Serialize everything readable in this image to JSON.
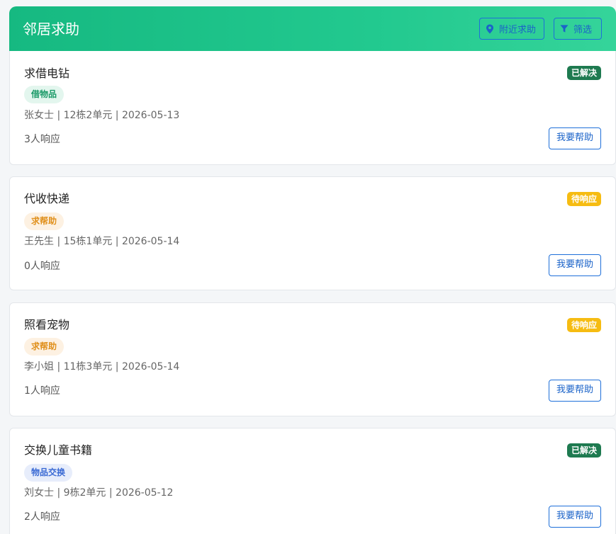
{
  "header": {
    "title": "邻居求助",
    "nearby_label": "附近求助",
    "filter_label": "筛选"
  },
  "colors": {
    "header_gradient_start": "#16b981",
    "header_gradient_end": "#35d49a",
    "solved": "#1e7a50",
    "pending": "#f6bc12",
    "action_blue": "#1e6fd9"
  },
  "icons": {
    "nearby": "map-pin-icon",
    "filter": "funnel-icon"
  },
  "posts": [
    {
      "title": "求借电钻",
      "status": "已解决",
      "status_kind": "solved",
      "tag": "借物品",
      "tag_kind": "green",
      "meta": "张女士 | 12栋2单元 | 2026-05-13",
      "responses": "3人响应",
      "action": "我要帮助"
    },
    {
      "title": "代收快递",
      "status": "待响应",
      "status_kind": "pending",
      "tag": "求帮助",
      "tag_kind": "orange",
      "meta": "王先生 | 15栋1单元 | 2026-05-14",
      "responses": "0人响应",
      "action": "我要帮助"
    },
    {
      "title": "照看宠物",
      "status": "待响应",
      "status_kind": "pending",
      "tag": "求帮助",
      "tag_kind": "orange",
      "meta": "李小姐 | 11栋3单元 | 2026-05-14",
      "responses": "1人响应",
      "action": "我要帮助"
    },
    {
      "title": "交换儿童书籍",
      "status": "已解决",
      "status_kind": "solved",
      "tag": "物品交换",
      "tag_kind": "blue",
      "meta": "刘女士 | 9栋2单元 | 2026-05-12",
      "responses": "2人响应",
      "action": "我要帮助"
    }
  ]
}
